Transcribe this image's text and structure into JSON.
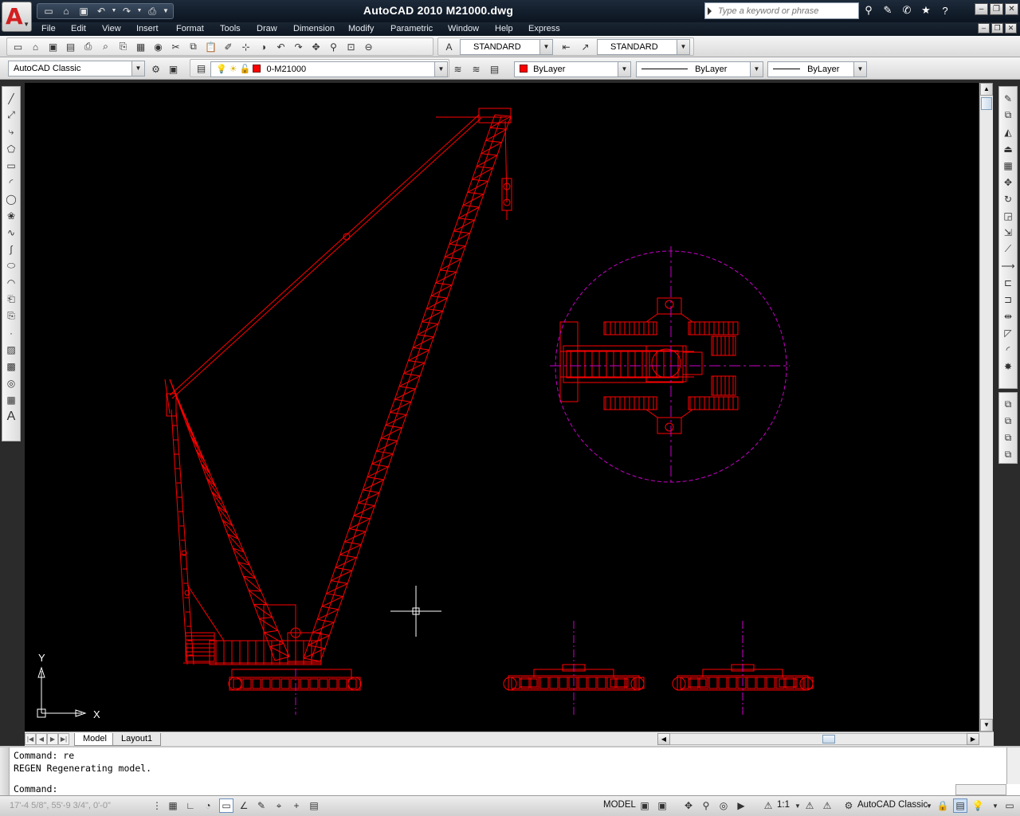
{
  "window": {
    "title": "AutoCAD 2010    M21000.dwg",
    "search_placeholder": "Type a keyword or phrase"
  },
  "menu": [
    "File",
    "Edit",
    "View",
    "Insert",
    "Format",
    "Tools",
    "Draw",
    "Dimension",
    "Modify",
    "Parametric",
    "Window",
    "Help",
    "Express"
  ],
  "styles": {
    "text_style": "STANDARD",
    "dim_style": "STANDARD"
  },
  "layers_row": {
    "workspace": "AutoCAD Classic",
    "layer": "0-M21000",
    "color": "ByLayer",
    "linetype": "ByLayer",
    "lineweight": "ByLayer"
  },
  "layout_tabs": [
    "Model",
    "Layout1"
  ],
  "ucs": {
    "x_label": "X",
    "y_label": "Y"
  },
  "command": {
    "history": [
      "Command: re",
      "REGEN Regenerating model."
    ],
    "prompt": "Command:"
  },
  "status": {
    "coordinates": "17'-4 5/8\", 55'-9 3/4\", 0'-0\"",
    "model_label": "MODEL",
    "annotation_scale": "1:1",
    "workspace": "AutoCAD Classic"
  },
  "colors": {
    "drawing": "#ff0000",
    "centerline": "#c800c8",
    "canvas_bg": "#000000",
    "crosshair": "#ffffff"
  }
}
